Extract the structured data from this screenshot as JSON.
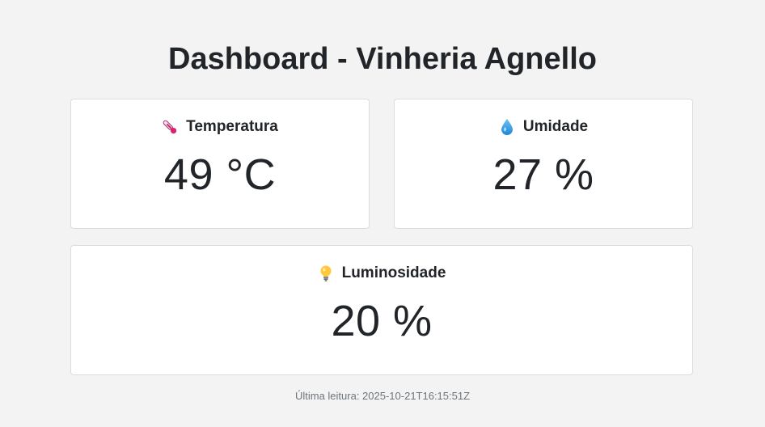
{
  "header": {
    "title": "Dashboard - Vinheria Agnello"
  },
  "cards": {
    "temperature": {
      "icon": "thermometer-icon",
      "label": "Temperatura",
      "value": "49 °C"
    },
    "humidity": {
      "icon": "water-drop-icon",
      "label": "Umidade",
      "value": "27 %"
    },
    "luminosity": {
      "icon": "light-bulb-icon",
      "label": "Luminosidade",
      "value": "20 %"
    }
  },
  "footer": {
    "last_reading": "Última leitura: 2025-10-21T16:15:51Z"
  },
  "colors": {
    "background": "#f3f3f3",
    "card": "#ffffff",
    "text": "#212529",
    "muted": "#6c757d"
  }
}
